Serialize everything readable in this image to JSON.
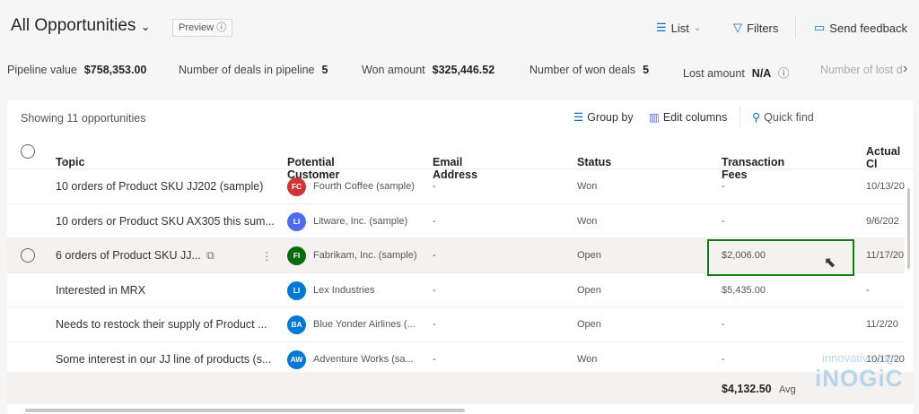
{
  "header": {
    "title": "All Opportunities",
    "preview": "Preview",
    "list": "List",
    "filters": "Filters",
    "feedback": "Send feedback"
  },
  "kpis": [
    {
      "label": "Pipeline value",
      "value": "$758,353.00"
    },
    {
      "label": "Number of deals in pipeline",
      "value": "5"
    },
    {
      "label": "Won amount",
      "value": "$325,446.52"
    },
    {
      "label": "Number of won deals",
      "value": "5"
    },
    {
      "label": "Lost amount",
      "value": "N/A"
    },
    {
      "label": "Number of lost d"
    }
  ],
  "grid": {
    "showing": "Showing 11 opportunities",
    "group_by": "Group by",
    "edit_columns": "Edit columns",
    "quick_find": "Quick find",
    "columns": [
      "Topic",
      "Potential Customer",
      "Email Address",
      "Status",
      "Transaction Fees",
      "Actual Cl"
    ],
    "rows": [
      {
        "topic": "10 orders of Product SKU JJ202 (sample)",
        "initials": "FC",
        "color": "#d13438",
        "customer": "Fourth Coffee (sample)",
        "email": "-",
        "status": "Won",
        "fees": "-",
        "close": "10/13/20"
      },
      {
        "topic": "10 orders or Product SKU AX305 this sum...",
        "initials": "LI",
        "color": "#4f6bed",
        "customer": "Litware, Inc. (sample)",
        "email": "-",
        "status": "Won",
        "fees": "-",
        "close": "9/6/202"
      },
      {
        "topic": "6 orders of Product SKU JJ...",
        "initials": "FI",
        "color": "#0b6a0b",
        "customer": "Fabrikam, Inc. (sample)",
        "email": "-",
        "status": "Open",
        "fees": "$2,006.00",
        "close": "11/17/20"
      },
      {
        "topic": "Interested in MRX",
        "initials": "LI",
        "color": "#0078d4",
        "customer": "Lex Industries",
        "email": "-",
        "status": "Open",
        "fees": "$5,435.00",
        "close": "-"
      },
      {
        "topic": "Needs to restock their supply of Product ...",
        "initials": "BA",
        "color": "#0078d4",
        "customer": "Blue Yonder Airlines (...",
        "email": "-",
        "status": "Open",
        "fees": "-",
        "close": "11/2/20"
      },
      {
        "topic": "Some interest in our JJ line of products (s...",
        "initials": "AW",
        "color": "#0078d4",
        "customer": "Adventure Works (sa...",
        "email": "-",
        "status": "Won",
        "fees": "-",
        "close": "10/17/20"
      }
    ],
    "footer": {
      "total": "$4,132.50",
      "agg": "Avg"
    }
  },
  "watermark": {
    "line1": "innovative logic",
    "line2": "inogic"
  }
}
